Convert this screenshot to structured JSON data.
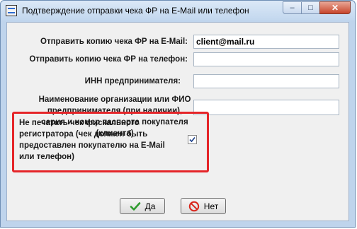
{
  "window": {
    "title": "Подтверждение отправки чека ФР на E-Mail или телефон",
    "icon": "app-icon"
  },
  "title_buttons": {
    "minimize": "–",
    "maximize": "□",
    "close": "✕"
  },
  "form": {
    "email": {
      "label": "Отправить копию чека ФР на  E-Mail:",
      "value": "client@mail.ru"
    },
    "phone": {
      "label": "Отправить копию чека ФР на телефон:",
      "value": ""
    },
    "inn": {
      "label": "ИНН предпринимателя:",
      "value": ""
    },
    "org_name": {
      "label": "Наименование организации или ФИО предпринимателя (при наличии), серия и номер паспорта покупателя (клиента)",
      "value": ""
    },
    "no_print": {
      "label": "Не печатать чек фискального регистратора (чек должен быть предоставлен покупателю на E-Mail или телефон)",
      "checked": true
    }
  },
  "buttons": {
    "yes": "Да",
    "no": "Нет"
  },
  "colors": {
    "highlight_border": "#e52529",
    "yes_icon": "#2e9b2e",
    "no_icon": "#d9261c"
  }
}
